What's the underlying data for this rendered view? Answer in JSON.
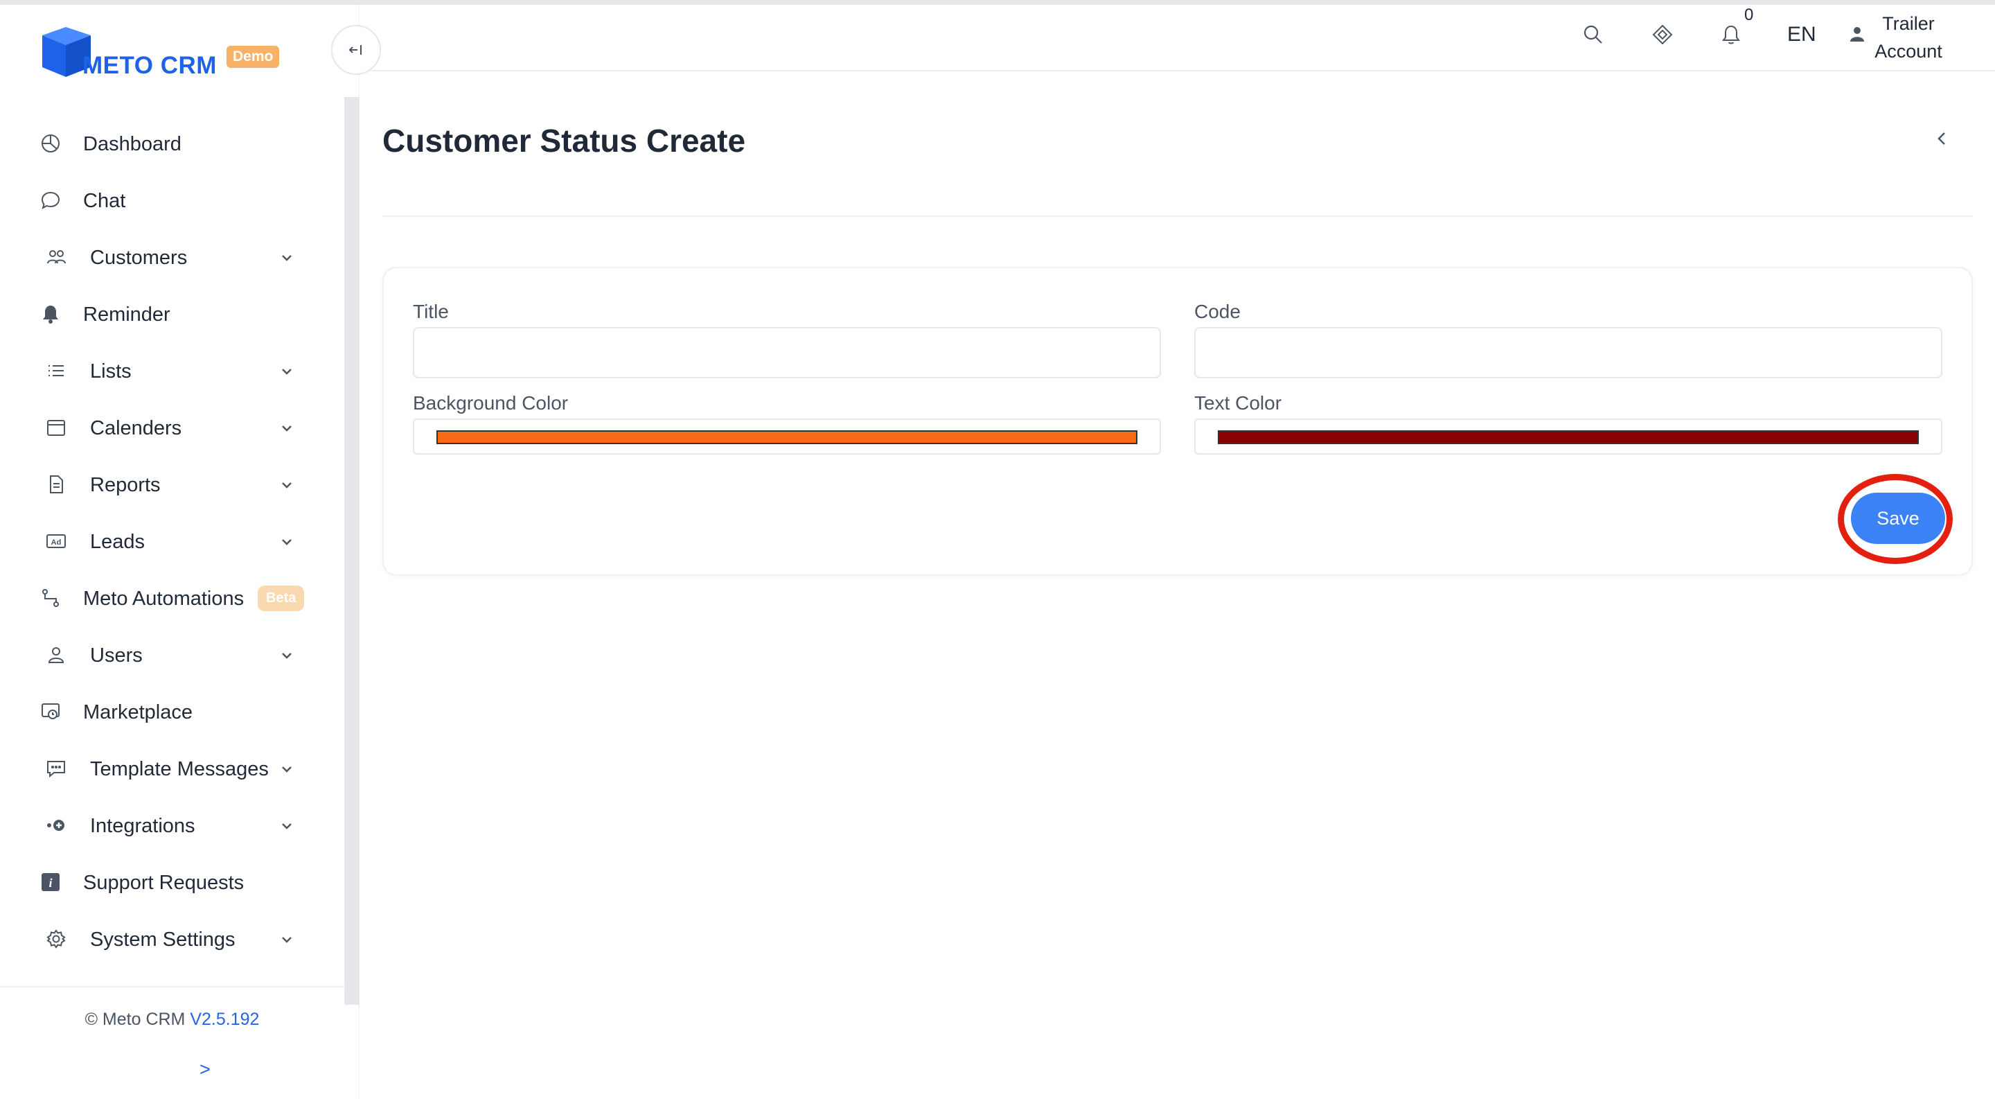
{
  "brand": {
    "name": "METO CRM",
    "badge": "Demo",
    "logo_color": "#1d62e8"
  },
  "sidebar": {
    "items": [
      {
        "label": "Dashboard",
        "icon": "pie-chart-icon",
        "has_submenu": false
      },
      {
        "label": "Chat",
        "icon": "chat-bubble-icon",
        "has_submenu": false
      },
      {
        "label": "Customers",
        "icon": "users-group-icon",
        "has_submenu": true
      },
      {
        "label": "Reminder",
        "icon": "bell-icon",
        "has_submenu": false
      },
      {
        "label": "Lists",
        "icon": "list-icon",
        "has_submenu": true
      },
      {
        "label": "Calenders",
        "icon": "calendar-icon",
        "has_submenu": true
      },
      {
        "label": "Reports",
        "icon": "document-icon",
        "has_submenu": true
      },
      {
        "label": "Leads",
        "icon": "ad-icon",
        "has_submenu": true
      },
      {
        "label": "Meto Automations",
        "icon": "automation-icon",
        "has_submenu": false,
        "badge": "Beta"
      },
      {
        "label": "Users",
        "icon": "user-icon",
        "has_submenu": true
      },
      {
        "label": "Marketplace",
        "icon": "marketplace-icon",
        "has_submenu": false
      },
      {
        "label": "Template Messages",
        "icon": "message-template-icon",
        "has_submenu": true
      },
      {
        "label": "Integrations",
        "icon": "plug-icon",
        "has_submenu": true
      },
      {
        "label": "Support Requests",
        "icon": "info-icon",
        "has_submenu": false
      },
      {
        "label": "System Settings",
        "icon": "gear-icon",
        "has_submenu": true
      }
    ],
    "footer": {
      "copyright": "© Meto CRM",
      "version": "V2.5.192",
      "expand": ">"
    }
  },
  "header": {
    "notification_count": "0",
    "language": "EN",
    "user_line1": "Trailer",
    "user_line2": "Account"
  },
  "page": {
    "title": "Customer Status Create",
    "form": {
      "title_label": "Title",
      "title_value": "",
      "code_label": "Code",
      "code_value": "",
      "background_color_label": "Background Color",
      "background_color_value": "#f76b15",
      "text_color_label": "Text Color",
      "text_color_value": "#8b0000",
      "save_label": "Save"
    }
  },
  "colors": {
    "accent": "#3b82f6",
    "highlight": "#e3200f"
  }
}
